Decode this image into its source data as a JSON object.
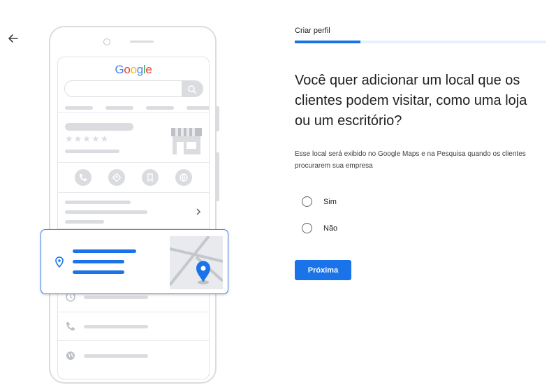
{
  "header": {
    "step_label": "Criar perfil",
    "progress": 0.26
  },
  "main": {
    "question": "Você quer adicionar um local que os clientes podem visitar, como uma loja ou um escritório?",
    "description": "Esse local será exibido no Google Maps e na Pesquisa quando os clientes procurarem sua empresa",
    "options": [
      {
        "label": "Sim",
        "selected": false
      },
      {
        "label": "Não",
        "selected": false
      }
    ],
    "next_button_label": "Próxima"
  },
  "illustration": {
    "logo_letters": [
      {
        "char": "G",
        "color": "#4285F4"
      },
      {
        "char": "o",
        "color": "#EA4335"
      },
      {
        "char": "o",
        "color": "#FBBC05"
      },
      {
        "char": "g",
        "color": "#4285F4"
      },
      {
        "char": "l",
        "color": "#34A853"
      },
      {
        "char": "e",
        "color": "#EA4335"
      }
    ],
    "stars": "★★★★★",
    "icons": [
      "phone-icon",
      "directions-icon",
      "bookmark-icon",
      "globe-icon",
      "location-pin-icon",
      "clock-icon"
    ]
  },
  "colors": {
    "accent": "#1a73e8",
    "placeholder_gray": "#dadce0"
  }
}
